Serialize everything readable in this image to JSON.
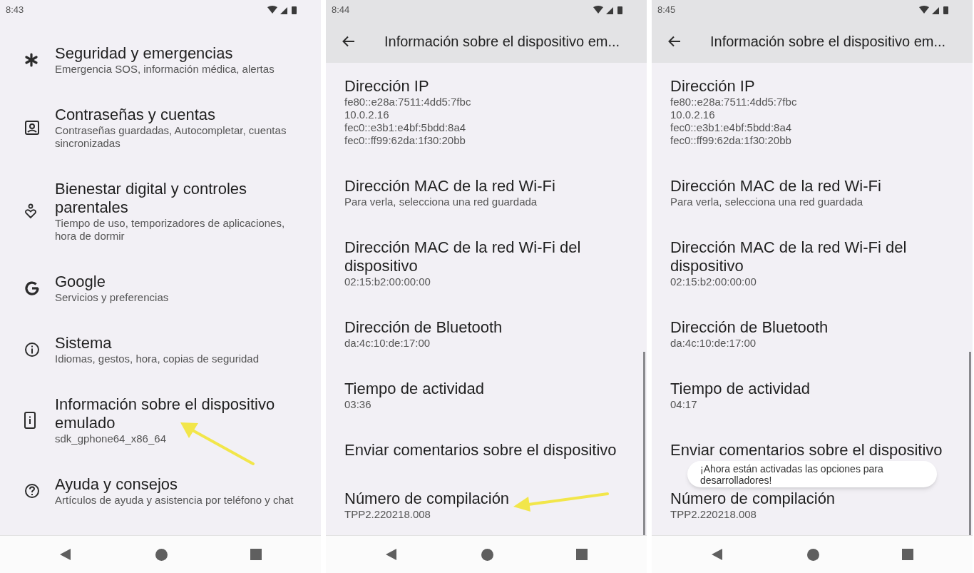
{
  "panels": [
    {
      "kind": "settings_list",
      "status_bar": {
        "time": "8:43"
      },
      "highlight_arrow": true,
      "items": [
        {
          "title": "Seguridad y emergencias",
          "subtitle": [
            "Emergencia SOS, información médica, alertas"
          ]
        },
        {
          "title": "Contraseñas y cuentas",
          "subtitle": [
            "Contraseñas guardadas, Autocompletar, cuentas sincronizadas"
          ]
        },
        {
          "title": "Bienestar digital y controles parentales",
          "subtitle": [
            "Tiempo de uso, temporizadores de aplicaciones, hora de dormir"
          ]
        },
        {
          "title": "Google",
          "subtitle": [
            "Servicios y preferencias"
          ]
        },
        {
          "title": "Sistema",
          "subtitle": [
            "Idiomas, gestos, hora, copias de seguridad"
          ]
        },
        {
          "title": "Información sobre el dispositivo emulado",
          "subtitle": [
            "sdk_gphone64_x86_64"
          ]
        },
        {
          "title": "Ayuda y consejos",
          "subtitle": [
            "Artículos de ayuda y asistencia por teléfono y chat"
          ]
        }
      ]
    },
    {
      "kind": "detail",
      "status_bar": {
        "time": "8:44"
      },
      "header": {
        "title": "Información sobre el dispositivo em..."
      },
      "highlight_arrow": true,
      "items": [
        {
          "title": "Dirección IP",
          "subtitle": [
            "fe80::e28a:7511:4dd5:7fbc",
            "10.0.2.16",
            "fec0::e3b1:e4bf:5bdd:8a4",
            "fec0::ff99:62da:1f30:20bb"
          ]
        },
        {
          "title": "Dirección MAC de la red Wi-Fi",
          "subtitle": [
            "Para verla, selecciona una red guardada"
          ]
        },
        {
          "title": "Dirección MAC de la red Wi-Fi del dispositivo",
          "subtitle": [
            "02:15:b2:00:00:00"
          ]
        },
        {
          "title": "Dirección de Bluetooth",
          "subtitle": [
            "da:4c:10:de:17:00"
          ]
        },
        {
          "title": "Tiempo de actividad",
          "subtitle": [
            "03:36"
          ]
        },
        {
          "title": "Enviar comentarios sobre el dispositivo"
        },
        {
          "title": "Número de compilación",
          "subtitle": [
            "TPP2.220218.008"
          ]
        }
      ]
    },
    {
      "kind": "detail",
      "status_bar": {
        "time": "8:45"
      },
      "header": {
        "title": "Información sobre el dispositivo em..."
      },
      "highlight_arrow": false,
      "toast": {
        "text": "¡Ahora están activadas las opciones para desarrolladores!"
      },
      "items": [
        {
          "title": "Dirección IP",
          "subtitle": [
            "fe80::e28a:7511:4dd5:7fbc",
            "10.0.2.16",
            "fec0::e3b1:e4bf:5bdd:8a4",
            "fec0::ff99:62da:1f30:20bb"
          ]
        },
        {
          "title": "Dirección MAC de la red Wi-Fi",
          "subtitle": [
            "Para verla, selecciona una red guardada"
          ]
        },
        {
          "title": "Dirección MAC de la red Wi-Fi del dispositivo",
          "subtitle": [
            "02:15:b2:00:00:00"
          ]
        },
        {
          "title": "Dirección de Bluetooth",
          "subtitle": [
            "da:4c:10:de:17:00"
          ]
        },
        {
          "title": "Tiempo de actividad",
          "subtitle": [
            "04:17"
          ]
        },
        {
          "title": "Enviar comentarios sobre el dispositivo"
        },
        {
          "title": "Número de compilación",
          "subtitle": [
            "TPP2.220218.008"
          ]
        }
      ]
    }
  ]
}
